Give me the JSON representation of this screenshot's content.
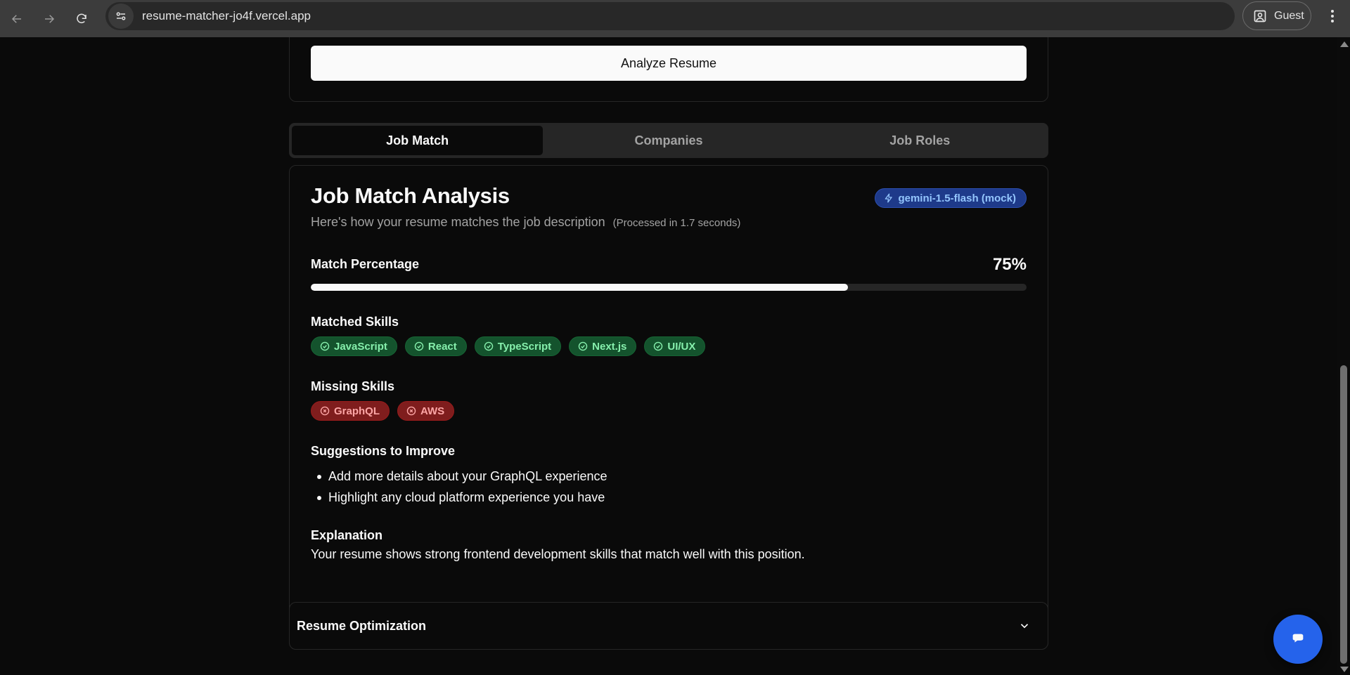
{
  "browser": {
    "url": "resume-matcher-jo4f.vercel.app",
    "profile_label": "Guest"
  },
  "upload": {
    "analyze_label": "Analyze Resume"
  },
  "tabs": [
    {
      "label": "Job Match",
      "active": true
    },
    {
      "label": "Companies",
      "active": false
    },
    {
      "label": "Job Roles",
      "active": false
    }
  ],
  "result": {
    "title": "Job Match Analysis",
    "subtitle": "Here's how your resume matches the job description",
    "processed": "(Processed in 1.7 seconds)",
    "model_badge": "gemini-1.5-flash (mock)",
    "match_label": "Match Percentage",
    "match_value": "75%",
    "match_fraction": 0.75,
    "matched_label": "Matched Skills",
    "matched_skills": [
      "JavaScript",
      "React",
      "TypeScript",
      "Next.js",
      "UI/UX"
    ],
    "missing_label": "Missing Skills",
    "missing_skills": [
      "GraphQL",
      "AWS"
    ],
    "suggestions_label": "Suggestions to Improve",
    "suggestions": [
      "Add more details about your GraphQL experience",
      "Highlight any cloud platform experience you have"
    ],
    "explanation_label": "Explanation",
    "explanation": "Your resume shows strong frontend development skills that match well with this position."
  },
  "accordion": {
    "label": "Resume Optimization"
  },
  "colors": {
    "accent_blue": "#2563eb",
    "matched_chip_bg": "#14532d",
    "missing_chip_bg": "#7f1d1d",
    "badge_bg": "#1e3a8a"
  },
  "icons": {
    "nav": [
      "back-icon",
      "forward-icon",
      "reload-icon"
    ],
    "site_info": "site-info-icon",
    "profile": "profile-icon",
    "menu": "more-vert-icon",
    "badge": "lightning-icon",
    "matched": "check-circle-icon",
    "missing": "x-circle-icon",
    "accordion": "chevron-down-icon",
    "chat": "chat-bubble-icon"
  }
}
